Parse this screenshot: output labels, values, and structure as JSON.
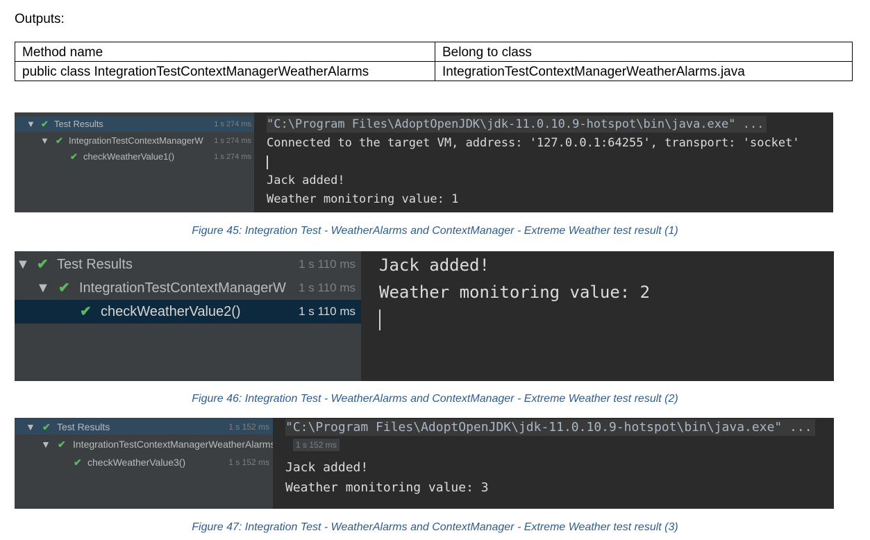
{
  "heading": "Outputs:",
  "table": {
    "headers": [
      "Method name",
      "Belong to class"
    ],
    "rows": [
      [
        "public class IntegrationTestContextManagerWeatherAlarms",
        "IntegrationTestContextManagerWeatherAlarms.java"
      ]
    ]
  },
  "colors": {
    "check": "#5fb85f",
    "caption": "#2e5d8e",
    "selected_row": "#0d293e"
  },
  "figures": [
    {
      "tree": [
        {
          "label": "Test Results",
          "time": "1 s 274 ms",
          "icon": "check-icon"
        },
        {
          "label": "IntegrationTestContextManagerW",
          "time": "1 s 274 ms",
          "icon": "check-icon"
        },
        {
          "label": "checkWeatherValue1()",
          "time": "1 s 274 ms",
          "icon": "check-icon"
        }
      ],
      "console": {
        "command": "\"C:\\Program Files\\AdoptOpenJDK\\jdk-11.0.10.9-hotspot\\bin\\java.exe\" ...",
        "connected": "Connected to the target VM, address: '127.0.0.1:64255', transport: 'socket'",
        "line1": "Jack added!",
        "line2": "Weather monitoring value: 1"
      },
      "caption": "Figure 45: Integration Test - WeatherAlarms and ContextManager - Extreme Weather test result (1)"
    },
    {
      "tree": [
        {
          "label": "Test Results",
          "time": "1 s 110 ms",
          "icon": "check-icon"
        },
        {
          "label": "IntegrationTestContextManagerW",
          "time": "1 s 110 ms",
          "icon": "check-icon"
        },
        {
          "label": "checkWeatherValue2()",
          "time": "1 s 110 ms",
          "icon": "check-icon"
        }
      ],
      "console": {
        "line1": "Jack added!",
        "line2": "Weather monitoring value: 2"
      },
      "caption": "Figure 46: Integration Test - WeatherAlarms and ContextManager - Extreme Weather test result (2)"
    },
    {
      "tree": [
        {
          "label": "Test Results",
          "time": "1 s 152 ms",
          "icon": "check-icon"
        },
        {
          "label": "IntegrationTestContextManagerWeatherAlarms",
          "time": "1 s 152 ms",
          "icon": "check-icon"
        },
        {
          "label": "checkWeatherValue3()",
          "time": "1 s 152 ms",
          "icon": "check-icon"
        }
      ],
      "console": {
        "command": "\"C:\\Program Files\\AdoptOpenJDK\\jdk-11.0.10.9-hotspot\\bin\\java.exe\" ...",
        "line1": "Jack added!",
        "line2": "Weather monitoring value: 3"
      },
      "caption": "Figure 47: Integration Test - WeatherAlarms and ContextManager - Extreme Weather test result (3)"
    }
  ]
}
